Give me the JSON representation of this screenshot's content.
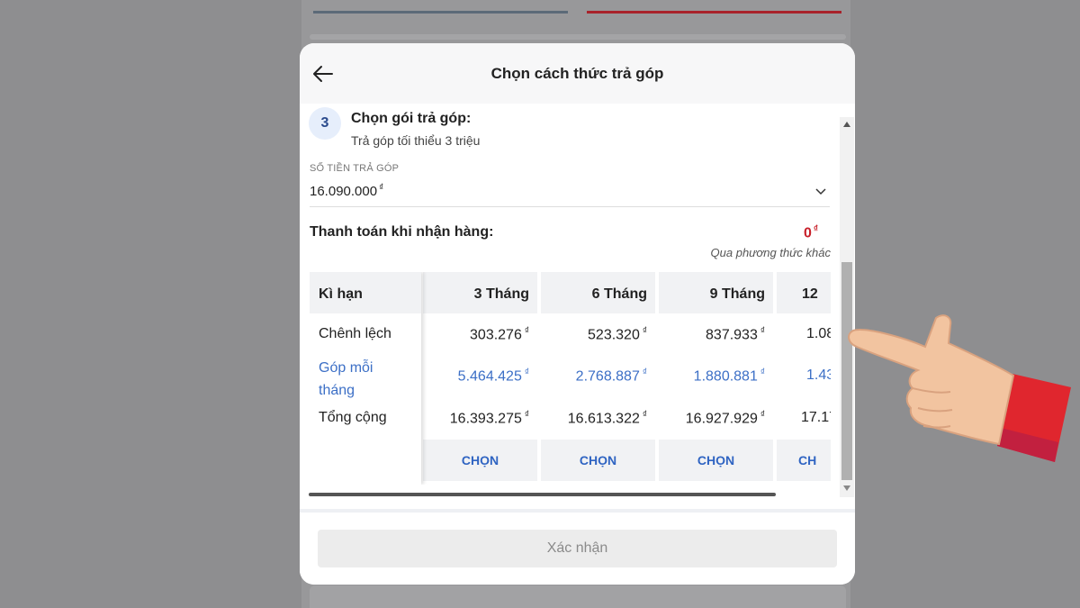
{
  "modal": {
    "title": "Chọn cách thức trả góp"
  },
  "step": {
    "number": "3",
    "title": "Chọn gói trả góp:",
    "subtitle": "Trả góp tối thiểu 3 triệu"
  },
  "amount_field": {
    "label": "SỐ TIỀN TRẢ GÓP",
    "value": "16.090.000",
    "currency": "₫"
  },
  "cod": {
    "label": "Thanh toán khi nhận hàng:",
    "amount": "0",
    "currency": "₫",
    "note": "Qua phương thức khác"
  },
  "table": {
    "header_label": "Kì hạn",
    "row_labels": [
      "Chênh lệch",
      "Góp mỗi tháng",
      "Tổng cộng"
    ],
    "columns": [
      {
        "term": "3 Tháng",
        "difference": "303.276",
        "monthly": "5.464.425",
        "total": "16.393.275",
        "button": "CHỌN"
      },
      {
        "term": "6 Tháng",
        "difference": "523.320",
        "monthly": "2.768.887",
        "total": "16.613.322",
        "button": "CHỌN"
      },
      {
        "term": "9 Tháng",
        "difference": "837.933",
        "monthly": "1.880.881",
        "total": "16.927.929",
        "button": "CHỌN"
      },
      {
        "term": "12",
        "difference": "1.08",
        "monthly": "1.43",
        "total": "17.17",
        "button": "CH"
      }
    ],
    "currency": "₫"
  },
  "footer": {
    "confirm_label": "Xác nhận"
  },
  "colors": {
    "accent_blue": "#3c6fc6",
    "price_red": "#c8202a",
    "header_bg": "#f1f2f4"
  },
  "icons": [
    "arrow-left-icon",
    "chevron-down-icon",
    "pointing-hand-icon"
  ]
}
